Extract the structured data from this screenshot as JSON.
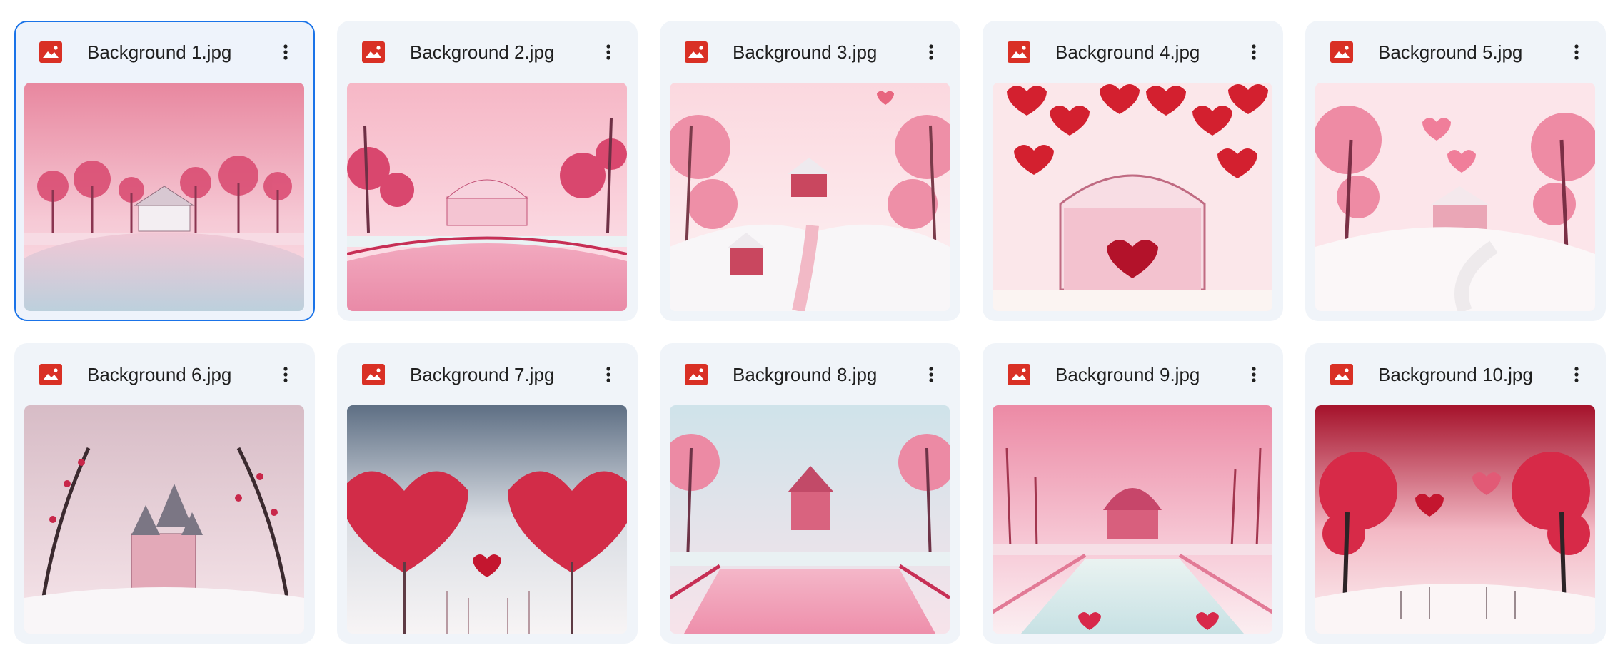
{
  "files": [
    {
      "name": "Background 1.jpg",
      "selected": true,
      "icon": "image-file-icon",
      "menu_icon": "more-vert-icon",
      "scene": "gazebo-lake"
    },
    {
      "name": "Background 2.jpg",
      "selected": false,
      "icon": "image-file-icon",
      "menu_icon": "more-vert-icon",
      "scene": "pavilion-pond"
    },
    {
      "name": "Background 3.jpg",
      "selected": false,
      "icon": "image-file-icon",
      "menu_icon": "more-vert-icon",
      "scene": "snowy-village"
    },
    {
      "name": "Background 4.jpg",
      "selected": false,
      "icon": "image-file-icon",
      "menu_icon": "more-vert-icon",
      "scene": "hearts-archway"
    },
    {
      "name": "Background 5.jpg",
      "selected": false,
      "icon": "image-file-icon",
      "menu_icon": "more-vert-icon",
      "scene": "snowy-house"
    },
    {
      "name": "Background 6.jpg",
      "selected": false,
      "icon": "image-file-icon",
      "menu_icon": "more-vert-icon",
      "scene": "castle"
    },
    {
      "name": "Background 7.jpg",
      "selected": false,
      "icon": "image-file-icon",
      "menu_icon": "more-vert-icon",
      "scene": "heart-trees"
    },
    {
      "name": "Background 8.jpg",
      "selected": false,
      "icon": "image-file-icon",
      "menu_icon": "more-vert-icon",
      "scene": "pink-pool"
    },
    {
      "name": "Background 9.jpg",
      "selected": false,
      "icon": "image-file-icon",
      "menu_icon": "more-vert-icon",
      "scene": "domed-pavilion"
    },
    {
      "name": "Background 10.jpg",
      "selected": false,
      "icon": "image-file-icon",
      "menu_icon": "more-vert-icon",
      "scene": "red-heart-forest"
    }
  ],
  "colors": {
    "card_bg": "#f0f4f9",
    "selected_border": "#1a73e8",
    "file_icon_red": "#d93025",
    "text": "#1f1f1f"
  }
}
